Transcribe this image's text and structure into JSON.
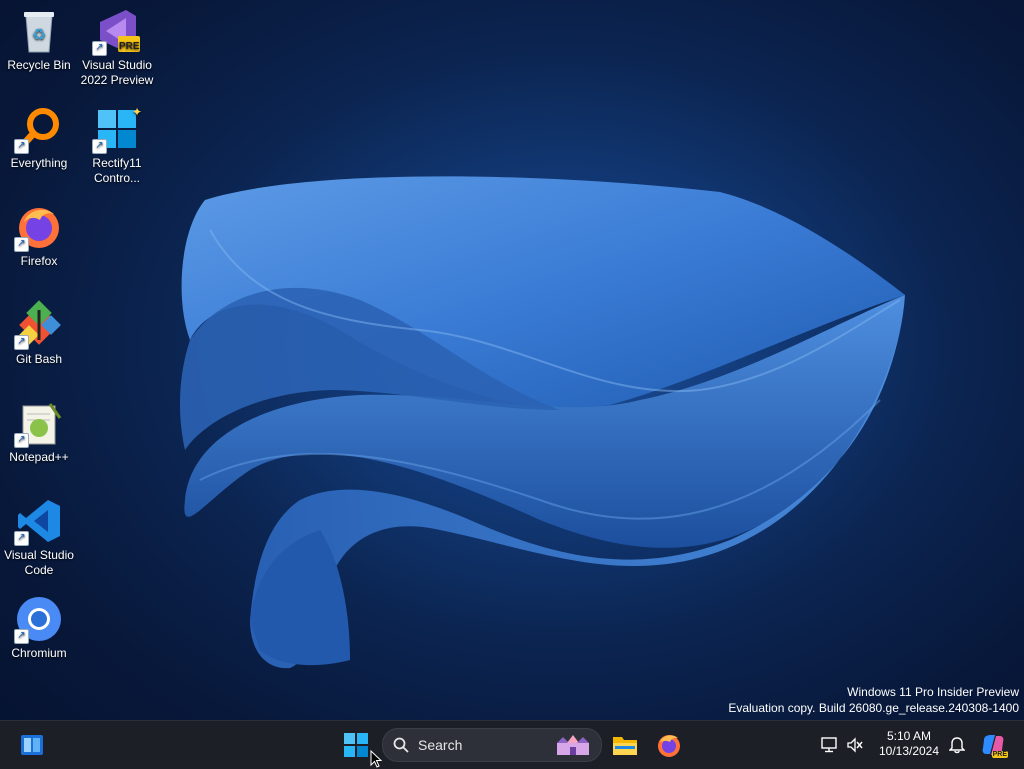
{
  "desktop": {
    "icons": [
      {
        "label": "Recycle Bin",
        "icon": "recycle-bin-icon"
      },
      {
        "label": "Visual Studio 2022 Preview",
        "icon": "visual-studio-icon",
        "badge": "PRE"
      },
      {
        "label": "Everything",
        "icon": "everything-search-icon"
      },
      {
        "label": "Rectify11 Contro...",
        "icon": "windows-control-icon"
      },
      {
        "label": "Firefox",
        "icon": "firefox-icon"
      },
      {
        "label": "Git Bash",
        "icon": "git-icon"
      },
      {
        "label": "Notepad++",
        "icon": "notepad-plus-plus-icon"
      },
      {
        "label": "Visual Studio Code",
        "icon": "vscode-icon"
      },
      {
        "label": "Chromium",
        "icon": "chromium-icon"
      }
    ]
  },
  "watermark": {
    "line1": "Windows 11 Pro Insider Preview",
    "line2": "Evaluation copy. Build 26080.ge_release.240308-1400"
  },
  "taskbar": {
    "search_placeholder": "Search",
    "apps": [
      "widgets-icon",
      "start-icon",
      "file-explorer-icon",
      "firefox-icon"
    ],
    "tray_icons": [
      "network-icon",
      "volume-muted-icon",
      "notification-bell-icon",
      "copilot-icon"
    ],
    "time": "5:10 AM",
    "date": "10/13/2024",
    "copilot_badge": "PRE"
  },
  "colors": {
    "accent": "#0078d4",
    "taskbar_bg": "#1c1f26"
  }
}
